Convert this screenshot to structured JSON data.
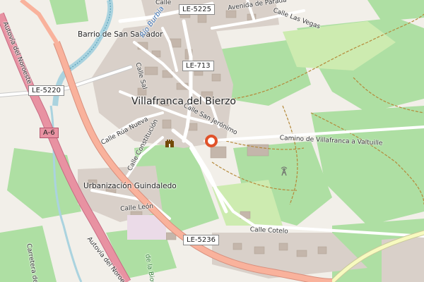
{
  "map": {
    "places": {
      "town": "Villafranca del Bierzo",
      "barrio": "Barrio de San Salvador",
      "urbanizacion": "Urbanización Guindaledo"
    },
    "river": "Río Burbia",
    "roads": {
      "le5225": "LE-5225",
      "le713": "LE-713",
      "le5220": "LE-5220",
      "a6": "A-6",
      "le5236": "LE-5236",
      "autovia_noroeste": "Autovía del Noroeste",
      "autovia_noroeste_2": "Autovía del Noroe",
      "carretera": "Carretera de",
      "calle_top": "Calle",
      "avenida_paradaseca": "Avenida de Parada",
      "calle_las_vegas": "Calle Las Vegas",
      "calle_salinas": "Calle Sal",
      "calle_rua_nueva": "Calle Rúa Nueva",
      "calle_constitucion": "Calle Constitución",
      "calle_san_jeronimo": "Calle San Jerónimo",
      "camino_valtuille": "Camino de Villafranca a Valtuille",
      "calle_leon": "Calle León",
      "calle_cotelo": "Calle Cotelo",
      "la_biosfera": "de la Biosfe"
    },
    "icons": [
      "location-marker",
      "castle-icon",
      "communication-tower-icon"
    ],
    "colors": {
      "background": "#f2efe9",
      "motorway": "#e892a2",
      "primary_road": "#f9b29c",
      "secondary_road": "#f7fabf",
      "water": "#aad3df",
      "vineyard": "#aedfa3",
      "built_area": "#d9d0c9",
      "marker": "#e0522a"
    }
  }
}
